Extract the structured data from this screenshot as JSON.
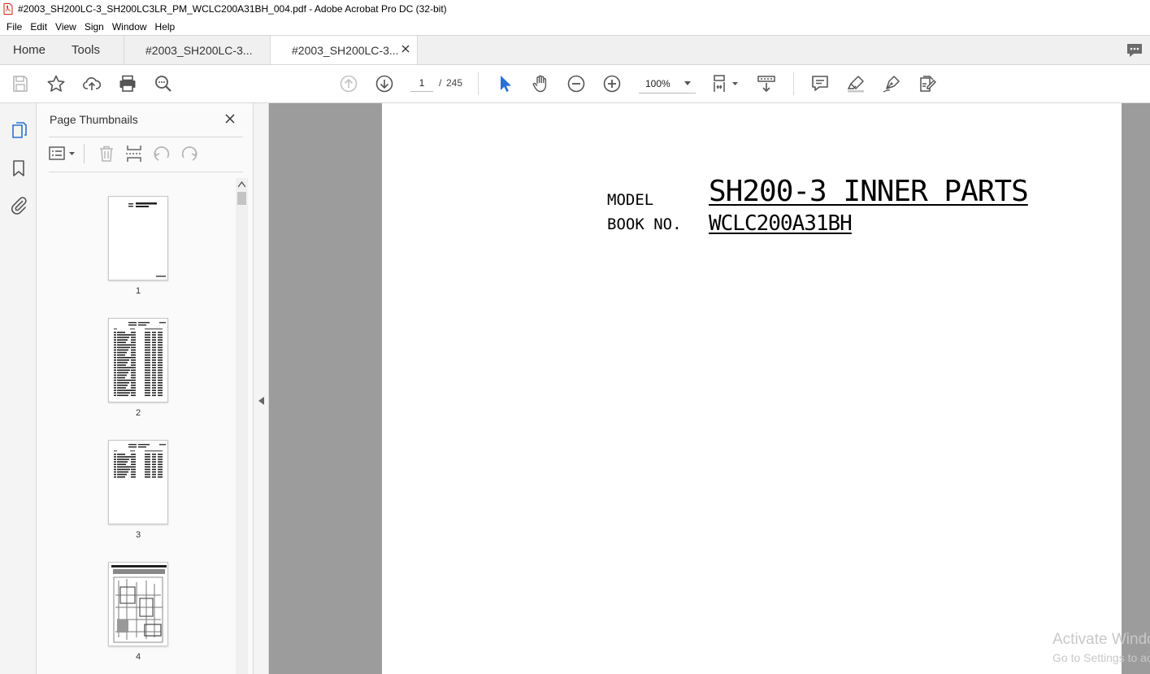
{
  "window": {
    "title": "#2003_SH200LC-3_SH200LC3LR_PM_WCLC200A31BH_004.pdf - Adobe Acrobat Pro DC (32-bit)"
  },
  "menu": [
    "File",
    "Edit",
    "View",
    "Sign",
    "Window",
    "Help"
  ],
  "tabs": {
    "home": "Home",
    "tools": "Tools",
    "doc1": "#2003_SH200LC-3...",
    "doc2": "#2003_SH200LC-3..."
  },
  "toolbar": {
    "page_current": "1",
    "page_separator": "/",
    "page_total": "245",
    "zoom": "100%"
  },
  "thumbnails": {
    "title": "Page Thumbnails",
    "pages": [
      "1",
      "2",
      "3",
      "4"
    ]
  },
  "document": {
    "model_label": "MODEL",
    "model_value": "SH200-3 INNER PARTS",
    "book_label": "BOOK NO.",
    "book_value": "WCLC200A31BH"
  },
  "watermark": {
    "line1": "Activate Windows",
    "line2": "Go to Settings to activate Windows."
  },
  "colors": {
    "accent_blue": "#2b6fd4",
    "pdf_red": "#d9230f",
    "doc_background": "#9c9c9c",
    "panel_background": "#fafafa"
  }
}
